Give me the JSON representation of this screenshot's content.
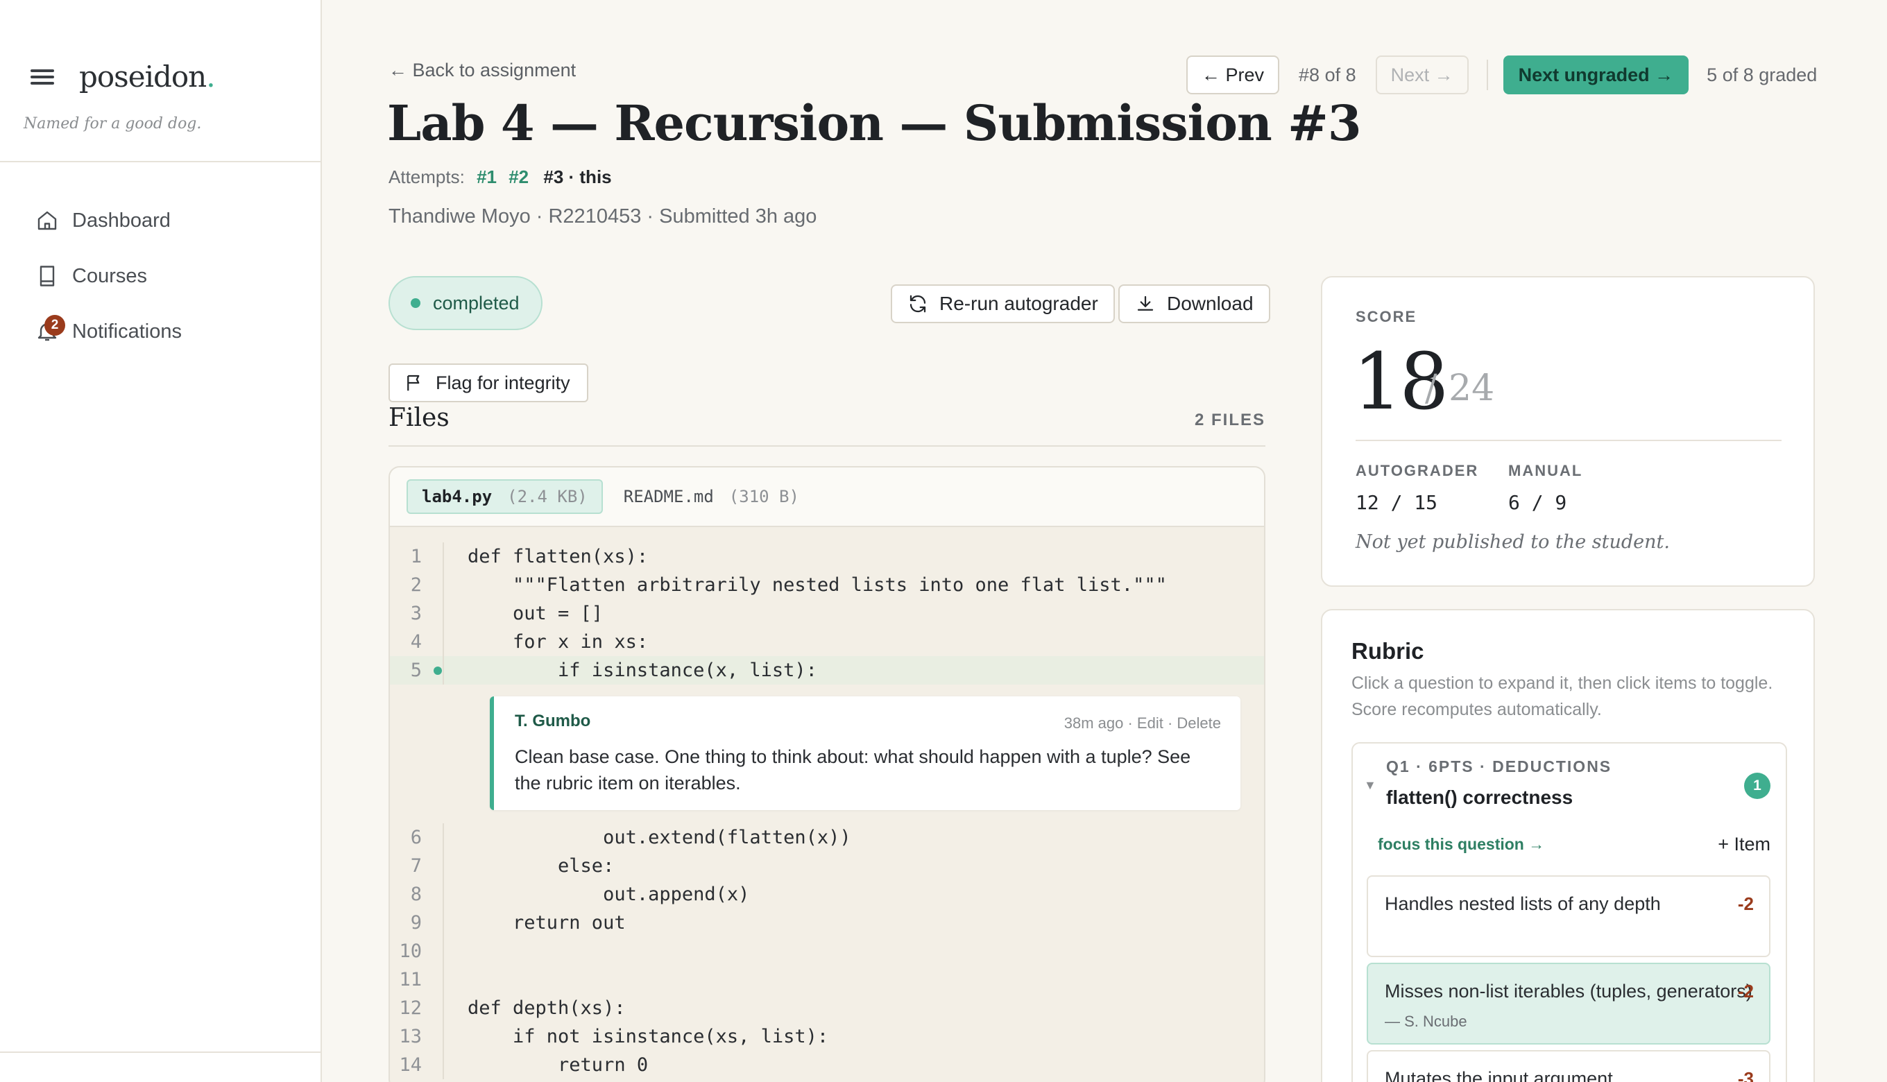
{
  "sidebar": {
    "brand": "poseidon",
    "brand_dot": ".",
    "tagline": "Named for a good dog.",
    "items": [
      {
        "label": "Dashboard",
        "icon": "home-icon"
      },
      {
        "label": "Courses",
        "icon": "book-icon"
      },
      {
        "label": "Notifications",
        "icon": "bell-icon",
        "badge": "2"
      }
    ]
  },
  "header": {
    "back": "← Back to assignment",
    "title": "Lab 4 — Recursion — Submission #3",
    "attempts_label": "Attempts:",
    "attempts": [
      "#1",
      "#2"
    ],
    "current_attempt": "#3 · this",
    "student_line": "Thandiwe Moyo · R2210453 · Submitted 3h ago"
  },
  "nav": {
    "prev": "← Prev",
    "position": "#8 of 8",
    "next": "Next →",
    "next_ungraded": "Next ungraded →",
    "graded": "5 of 8 graded"
  },
  "status": {
    "label": "completed",
    "color": "#3fae8f"
  },
  "actions": {
    "rerun": "Re-run autograder",
    "download": "Download",
    "flag": "Flag for integrity"
  },
  "files": {
    "title": "Files",
    "count": "2 FILES",
    "tabs": [
      {
        "name": "lab4.py",
        "size": "(2.4 KB)"
      },
      {
        "name": "README.md",
        "size": "(310 B)"
      }
    ],
    "lines": [
      {
        "n": "1",
        "code": "def flatten(xs):"
      },
      {
        "n": "2",
        "code": "    \"\"\"Flatten arbitrarily nested lists into one flat list.\"\"\""
      },
      {
        "n": "3",
        "code": "    out = []"
      },
      {
        "n": "4",
        "code": "    for x in xs:"
      },
      {
        "n": "5",
        "code": "        if isinstance(x, list):"
      },
      {
        "n": "6",
        "code": "            out.extend(flatten(x))"
      },
      {
        "n": "7",
        "code": "        else:"
      },
      {
        "n": "8",
        "code": "            out.append(x)"
      },
      {
        "n": "9",
        "code": "    return out"
      },
      {
        "n": "10",
        "code": ""
      },
      {
        "n": "11",
        "code": ""
      },
      {
        "n": "12",
        "code": "def depth(xs):"
      },
      {
        "n": "13",
        "code": "    if not isinstance(xs, list):"
      },
      {
        "n": "14",
        "code": "        return 0"
      }
    ],
    "comment": {
      "author": "T. Gumbo",
      "time": "38m ago",
      "edit": "Edit",
      "delete": "Delete",
      "text": "Clean base case. One thing to think about: what should happen with a tuple? See the rubric item on iterables."
    }
  },
  "score": {
    "label": "SCORE",
    "value": "18",
    "max": "/ 24",
    "autograder_label": "AUTOGRADER",
    "autograder_value": "12 / 15",
    "manual_label": "MANUAL",
    "manual_value": "6 / 9",
    "note": "Not yet published to the student."
  },
  "rubric": {
    "title": "Rubric",
    "help": "Click a question to expand it, then click items to toggle. Score recomputes automatically.",
    "question": {
      "meta": "Q1 · 6PTS · DEDUCTIONS",
      "name": "flatten() correctness",
      "count": "1",
      "focus": "focus this question →",
      "add": "+ Item",
      "items": [
        {
          "text": "Handles nested lists of any depth",
          "pts": "-2",
          "by": ""
        },
        {
          "text": "Misses non-list iterables (tuples, generators)",
          "pts": "-2",
          "by": "— S. Ncube"
        },
        {
          "text": "Mutates the input argument",
          "pts": "-3",
          "by": ""
        }
      ]
    }
  }
}
